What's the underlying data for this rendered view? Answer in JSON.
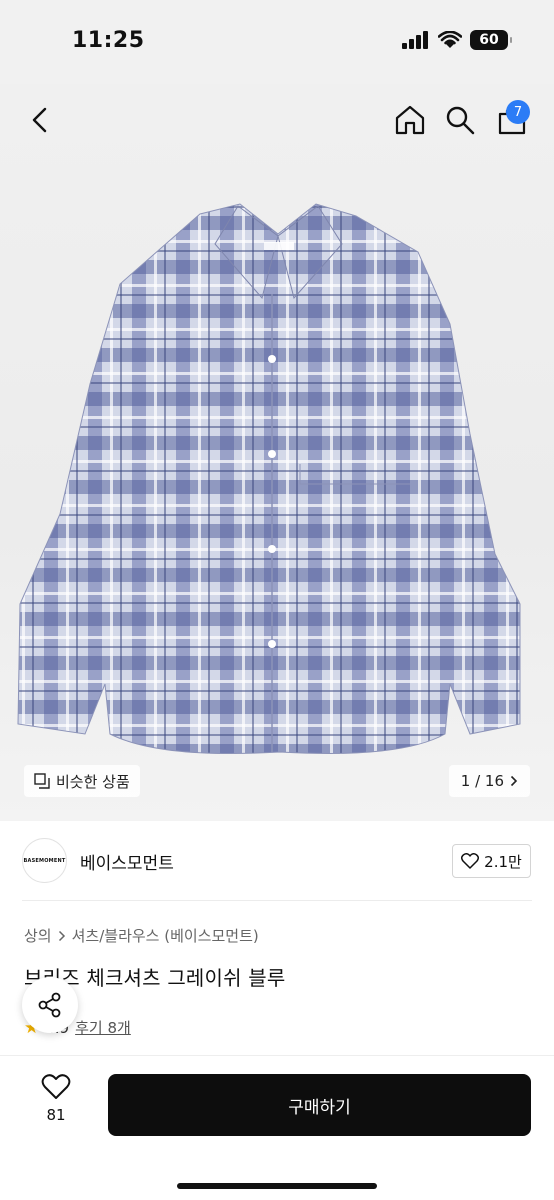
{
  "status_bar": {
    "time": "11:25",
    "battery": "60",
    "icons": [
      "signal-icon",
      "wifi-icon",
      "battery-icon"
    ]
  },
  "header": {
    "icons": [
      "back-arrow-icon",
      "home-icon",
      "search-icon",
      "cart-icon"
    ],
    "cart_badge": "7"
  },
  "gallery": {
    "similar_label": "비슷한 상품",
    "pager": "1 / 16",
    "image_description_icon": "plaid-shirt-image"
  },
  "brand": {
    "logo_text": "BASEMOMENT",
    "name": "베이스모먼트",
    "likes": "2.1만"
  },
  "product": {
    "breadcrumb": [
      "상의",
      "셔츠/블라우스 (베이스모먼트)"
    ],
    "title": "브리즈 체크셔츠 그레이쉬 블루",
    "rating": "4.9",
    "reviews": "후기 8개"
  },
  "bottom_bar": {
    "wish_count": "81",
    "buy_label": "구매하기"
  },
  "colors": {
    "badge": "#2b7cf6",
    "star": "#f4b400",
    "buy_button": "#0d0d0d",
    "shirt_base": "#c9cfe0",
    "shirt_dark": "#5a66a0"
  }
}
